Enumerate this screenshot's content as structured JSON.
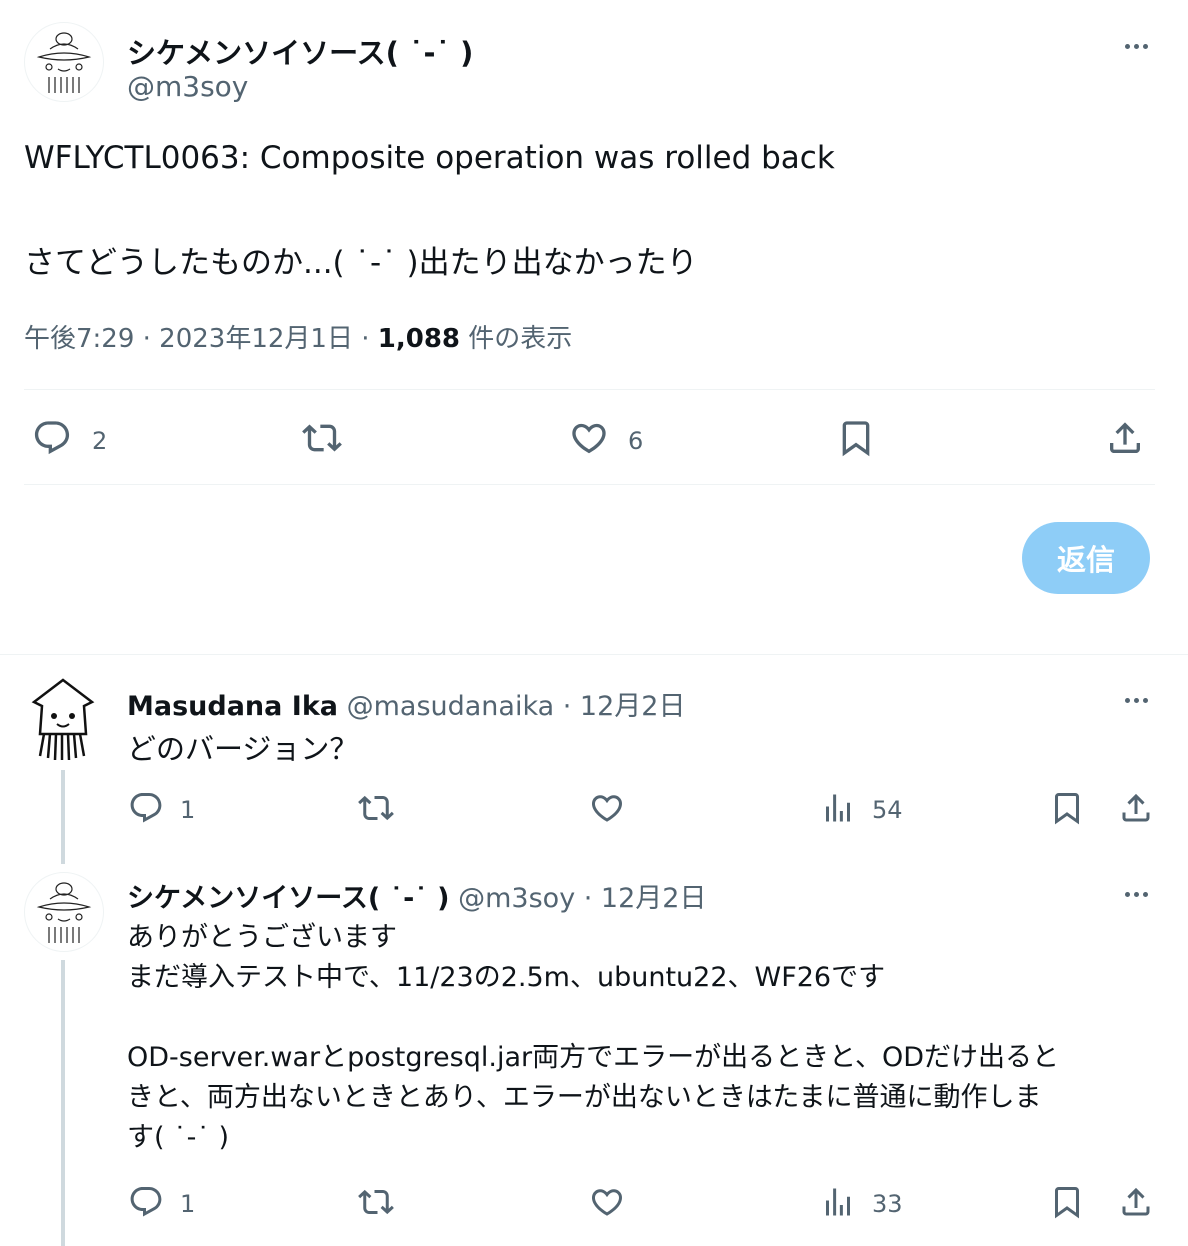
{
  "main_tweet": {
    "author_name": "シケメンソイソース( ˙-˙ )",
    "author_handle": "@m3soy",
    "text_line1": "WFLYCTL0063: Composite operation was rolled back",
    "text_line2": "さてどうしたものか...( ˙-˙ )出たり出なかったり",
    "time": "午後7:29 · 2023年12月1日 · ",
    "views_count": "1,088",
    "views_label": " 件の表示",
    "actions": {
      "reply_count": "2",
      "retweet_count": "",
      "like_count": "6"
    },
    "reply_button_label": "返信"
  },
  "replies": [
    {
      "author_name": "Masudana Ika",
      "author_handle": "@masudanaika",
      "date": " · 12月2日",
      "lines": [
        "どのバージョン？"
      ],
      "reply_count": "1",
      "retweet_count": "",
      "like_count": "",
      "views_count": "54"
    },
    {
      "author_name": "シケメンソイソース( ˙-˙ )",
      "author_handle": "@m3soy",
      "date": " · 12月2日",
      "lines": [
        "ありがとうございます",
        "まだ導入テスト中で、11/23の2.5m、ubuntu22、WF26です",
        "",
        "OD-server.warとpostgresql.jar両方でエラーが出るときと、ODだけ出ると",
        "きと、両方出ないときとあり、エラーが出ないときはたまに普通に動作しま",
        "す( ˙-˙ )"
      ],
      "reply_count": "1",
      "retweet_count": "",
      "like_count": "",
      "views_count": "33"
    }
  ],
  "colors": {
    "text_primary": "#0f1419",
    "text_secondary": "#536471",
    "divider": "#eff3f4",
    "reply_button": "#8ecdf7",
    "thread_line": "#cfd9de"
  }
}
